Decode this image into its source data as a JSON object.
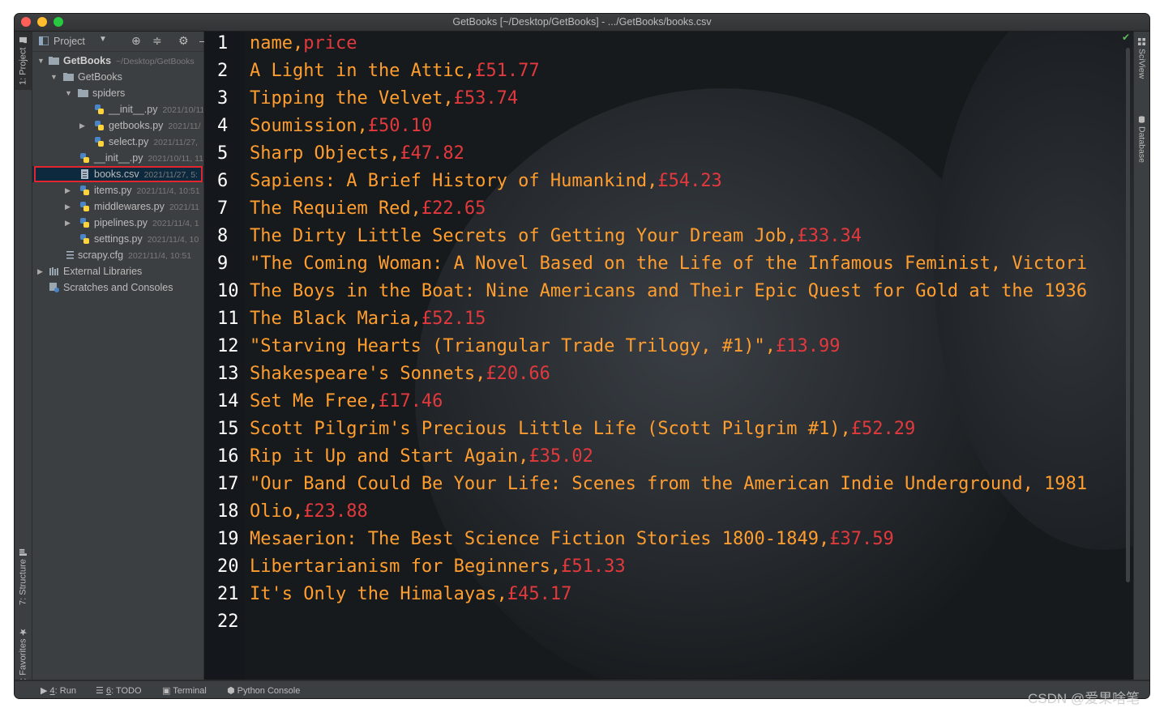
{
  "window_title": "GetBooks [~/Desktop/GetBooks] - .../GetBooks/books.csv",
  "left_tabs": {
    "project": "1: Project",
    "structure": "7: Structure",
    "favorites": "2: Favorites"
  },
  "right_tabs": {
    "sciview": "SciView",
    "database": "Database"
  },
  "project_panel": {
    "dropdown_label": "Project",
    "tree": [
      {
        "label": "GetBooks",
        "meta": "~/Desktop/GetBooks"
      },
      {
        "label": "GetBooks",
        "meta": ""
      },
      {
        "label": "spiders",
        "meta": ""
      },
      {
        "label": "__init__.py",
        "meta": "2021/10/11,"
      },
      {
        "label": "getbooks.py",
        "meta": "2021/11/"
      },
      {
        "label": "select.py",
        "meta": "2021/11/27,"
      },
      {
        "label": "__init__.py",
        "meta": "2021/10/11, 11:"
      },
      {
        "label": "books.csv",
        "meta": "2021/11/27, 5:"
      },
      {
        "label": "items.py",
        "meta": "2021/11/4, 10:51"
      },
      {
        "label": "middlewares.py",
        "meta": "2021/11"
      },
      {
        "label": "pipelines.py",
        "meta": "2021/11/4, 1"
      },
      {
        "label": "settings.py",
        "meta": "2021/11/4, 10"
      },
      {
        "label": "scrapy.cfg",
        "meta": "2021/11/4, 10:51"
      },
      {
        "label": "External Libraries",
        "meta": ""
      },
      {
        "label": "Scratches and Consoles",
        "meta": ""
      }
    ]
  },
  "editor": {
    "lines": [
      {
        "n": "1",
        "c1": "name,",
        "c2": "price"
      },
      {
        "n": "2",
        "c1": "A Light in the Attic,",
        "c2": "£51.77"
      },
      {
        "n": "3",
        "c1": "Tipping the Velvet,",
        "c2": "£53.74"
      },
      {
        "n": "4",
        "c1": "Soumission,",
        "c2": "£50.10"
      },
      {
        "n": "5",
        "c1": "Sharp Objects,",
        "c2": "£47.82"
      },
      {
        "n": "6",
        "c1": "Sapiens: A Brief History of Humankind,",
        "c2": "£54.23"
      },
      {
        "n": "7",
        "c1": "The Requiem Red,",
        "c2": "£22.65"
      },
      {
        "n": "8",
        "c1": "The Dirty Little Secrets of Getting Your Dream Job,",
        "c2": "£33.34"
      },
      {
        "n": "9",
        "c1": "\"The Coming Woman: A Novel Based on the Life of the Infamous Feminist, Victori",
        "c2": ""
      },
      {
        "n": "10",
        "c1": "The Boys in the Boat: Nine Americans and Their Epic Quest for Gold at the 1936",
        "c2": ""
      },
      {
        "n": "11",
        "c1": "The Black Maria,",
        "c2": "£52.15"
      },
      {
        "n": "12",
        "c1": "\"Starving Hearts (Triangular Trade Trilogy, #1)\",",
        "c2": "£13.99"
      },
      {
        "n": "13",
        "c1": "Shakespeare's Sonnets,",
        "c2": "£20.66"
      },
      {
        "n": "14",
        "c1": "Set Me Free,",
        "c2": "£17.46"
      },
      {
        "n": "15",
        "c1": "Scott Pilgrim's Precious Little Life (Scott Pilgrim #1),",
        "c2": "£52.29"
      },
      {
        "n": "16",
        "c1": "Rip it Up and Start Again,",
        "c2": "£35.02"
      },
      {
        "n": "17",
        "c1": "\"Our Band Could Be Your Life: Scenes from the American Indie Underground, 1981",
        "c2": ""
      },
      {
        "n": "18",
        "c1": "Olio,",
        "c2": "£23.88"
      },
      {
        "n": "19",
        "c1": "Mesaerion: The Best Science Fiction Stories 1800-1849,",
        "c2": "£37.59"
      },
      {
        "n": "20",
        "c1": "Libertarianism for Beginners,",
        "c2": "£51.33"
      },
      {
        "n": "21",
        "c1": "It's Only the Himalayas,",
        "c2": "£45.17"
      },
      {
        "n": "22",
        "c1": "",
        "c2": ""
      }
    ]
  },
  "bottom_bar": {
    "run": {
      "key": "4",
      "label": ": Run"
    },
    "todo": {
      "key": "6",
      "label": ": TODO"
    },
    "terminal": "Terminal",
    "python_console": "Python Console"
  },
  "watermark": "CSDN @爱果啥笔",
  "colors": {
    "code_text": "#ff9d2e",
    "price": "#e2393d",
    "selection_box": "#e3262e"
  }
}
